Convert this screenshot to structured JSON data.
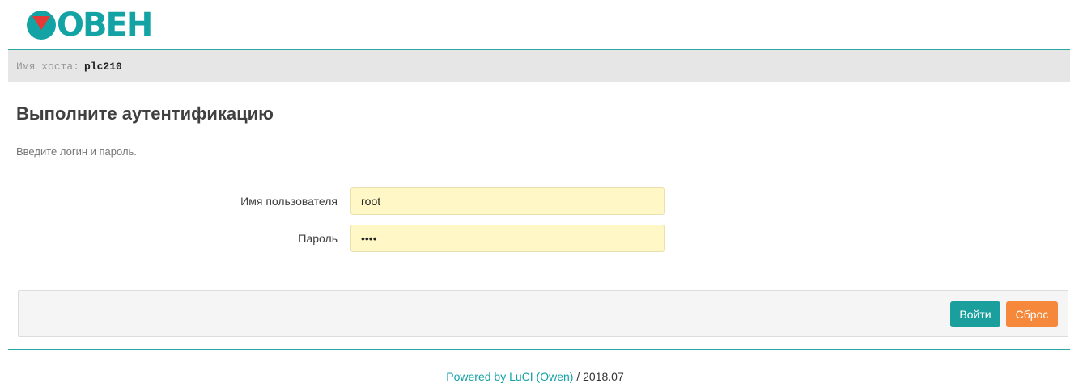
{
  "brand": {
    "logo_text": "ОВЕН"
  },
  "host": {
    "label": "Имя хоста:",
    "value": "plc210"
  },
  "auth": {
    "title": "Выполните аутентификацию",
    "description": "Введите логин и пароль.",
    "username_label": "Имя пользователя",
    "username_value": "root",
    "password_label": "Пароль",
    "password_value": "1234"
  },
  "actions": {
    "login_label": "Войти",
    "reset_label": "Сброс"
  },
  "footer": {
    "link_text": "Powered by LuCI (Owen)",
    "suffix": " / 2018.07"
  },
  "colors": {
    "accent": "#1a9f9d",
    "reset": "#f6883c",
    "logo_red": "#e53935",
    "input_bg": "#fff8c6"
  }
}
